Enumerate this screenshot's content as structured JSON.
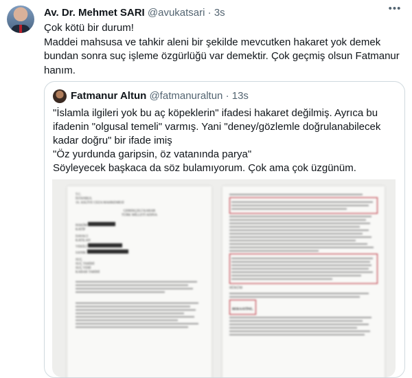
{
  "tweet": {
    "author_name": "Av. Dr. Mehmet SARI",
    "handle": "@avukatsari",
    "separator": "·",
    "time": "3s",
    "more_icon": "more-horizontal-icon",
    "text": "Çok kötü bir durum!\nMaddei mahsusa ve tahkir aleni bir şekilde mevcutken hakaret yok demek bundan sonra suç işleme özgürlüğü var demektir. Çok geçmiş olsun Fatmanur hanım."
  },
  "quoted_tweet": {
    "author_name": "Fatmanur Altun",
    "handle": "@fatmanuraltun",
    "separator": "·",
    "time": "13s",
    "lines": [
      "\"İslamla ilgileri yok bu aç köpeklerin\" ifadesi hakaret değilmiş. Ayrıca bu",
      "ifadenin \"olgusal temeli\" varmış. Yani \"deney/gözlemle doğrulanabilecek",
      "kadar doğru\" bir ifade imiş",
      "\"Öz yurdunda garipsin, öz vatanında parya\"",
      "Söyleyecek başkaca da söz bulamıyorum. Çok ama çok üzgünüm."
    ]
  },
  "document": {
    "left_page": {
      "header_lines": [
        "T.C.",
        "İSTANBUL",
        "16. ASLİYE CEZA MAHKEMESİ"
      ],
      "title_lines": [
        "GEREKÇELİ KARAR",
        "TÜRK MİLLETİ ADINA"
      ],
      "fields": [
        "HAKİM",
        "KATİP",
        "DAVACI",
        "KATILAN",
        "VEKİLİ",
        "SANIK",
        "SUÇ",
        "SUÇ TARİHİ",
        "SUÇ YERİ",
        "KARAR TARİHİ"
      ]
    },
    "right_page": {
      "verdict_label": "BERAATİNE,",
      "section_label": "HÜKÜM"
    }
  }
}
